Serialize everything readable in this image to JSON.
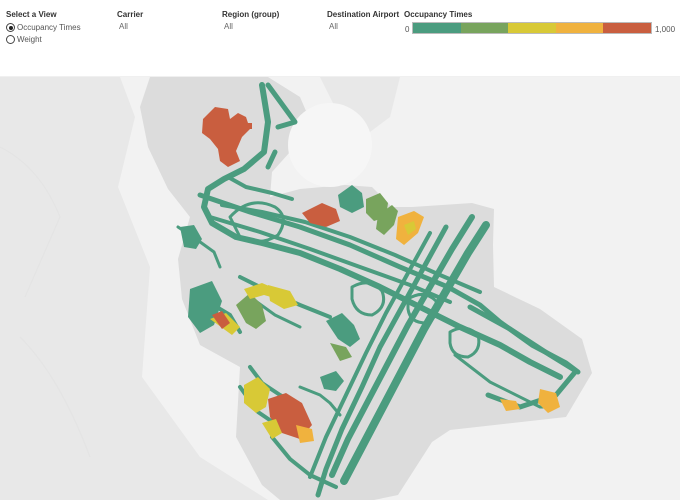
{
  "view_selector": {
    "title": "Select a View",
    "options": [
      {
        "label": "Occupancy Times",
        "checked": true
      },
      {
        "label": "Weight",
        "checked": false
      }
    ]
  },
  "filters": {
    "carrier": {
      "title": "Carrier",
      "value": "All"
    },
    "region": {
      "title": "Region (group)",
      "value": "All"
    },
    "destination": {
      "title": "Destination Airport",
      "value": "All"
    }
  },
  "legend": {
    "title": "Occupancy Times",
    "min_label": "0",
    "max_label": "1,000",
    "colors": [
      "#4b9c7f",
      "#78a45d",
      "#d8c936",
      "#f0b23e",
      "#c95e3f"
    ]
  },
  "map_colors": {
    "background": "#f2f2f2",
    "land": "#e8e8e8",
    "airport_ground": "#dcdcdc",
    "water": "#f6f6f6",
    "low": "#4b9c7f",
    "low_mid": "#78a45d",
    "mid": "#d8c936",
    "high_mid": "#f0b23e",
    "high": "#c95e3f"
  }
}
